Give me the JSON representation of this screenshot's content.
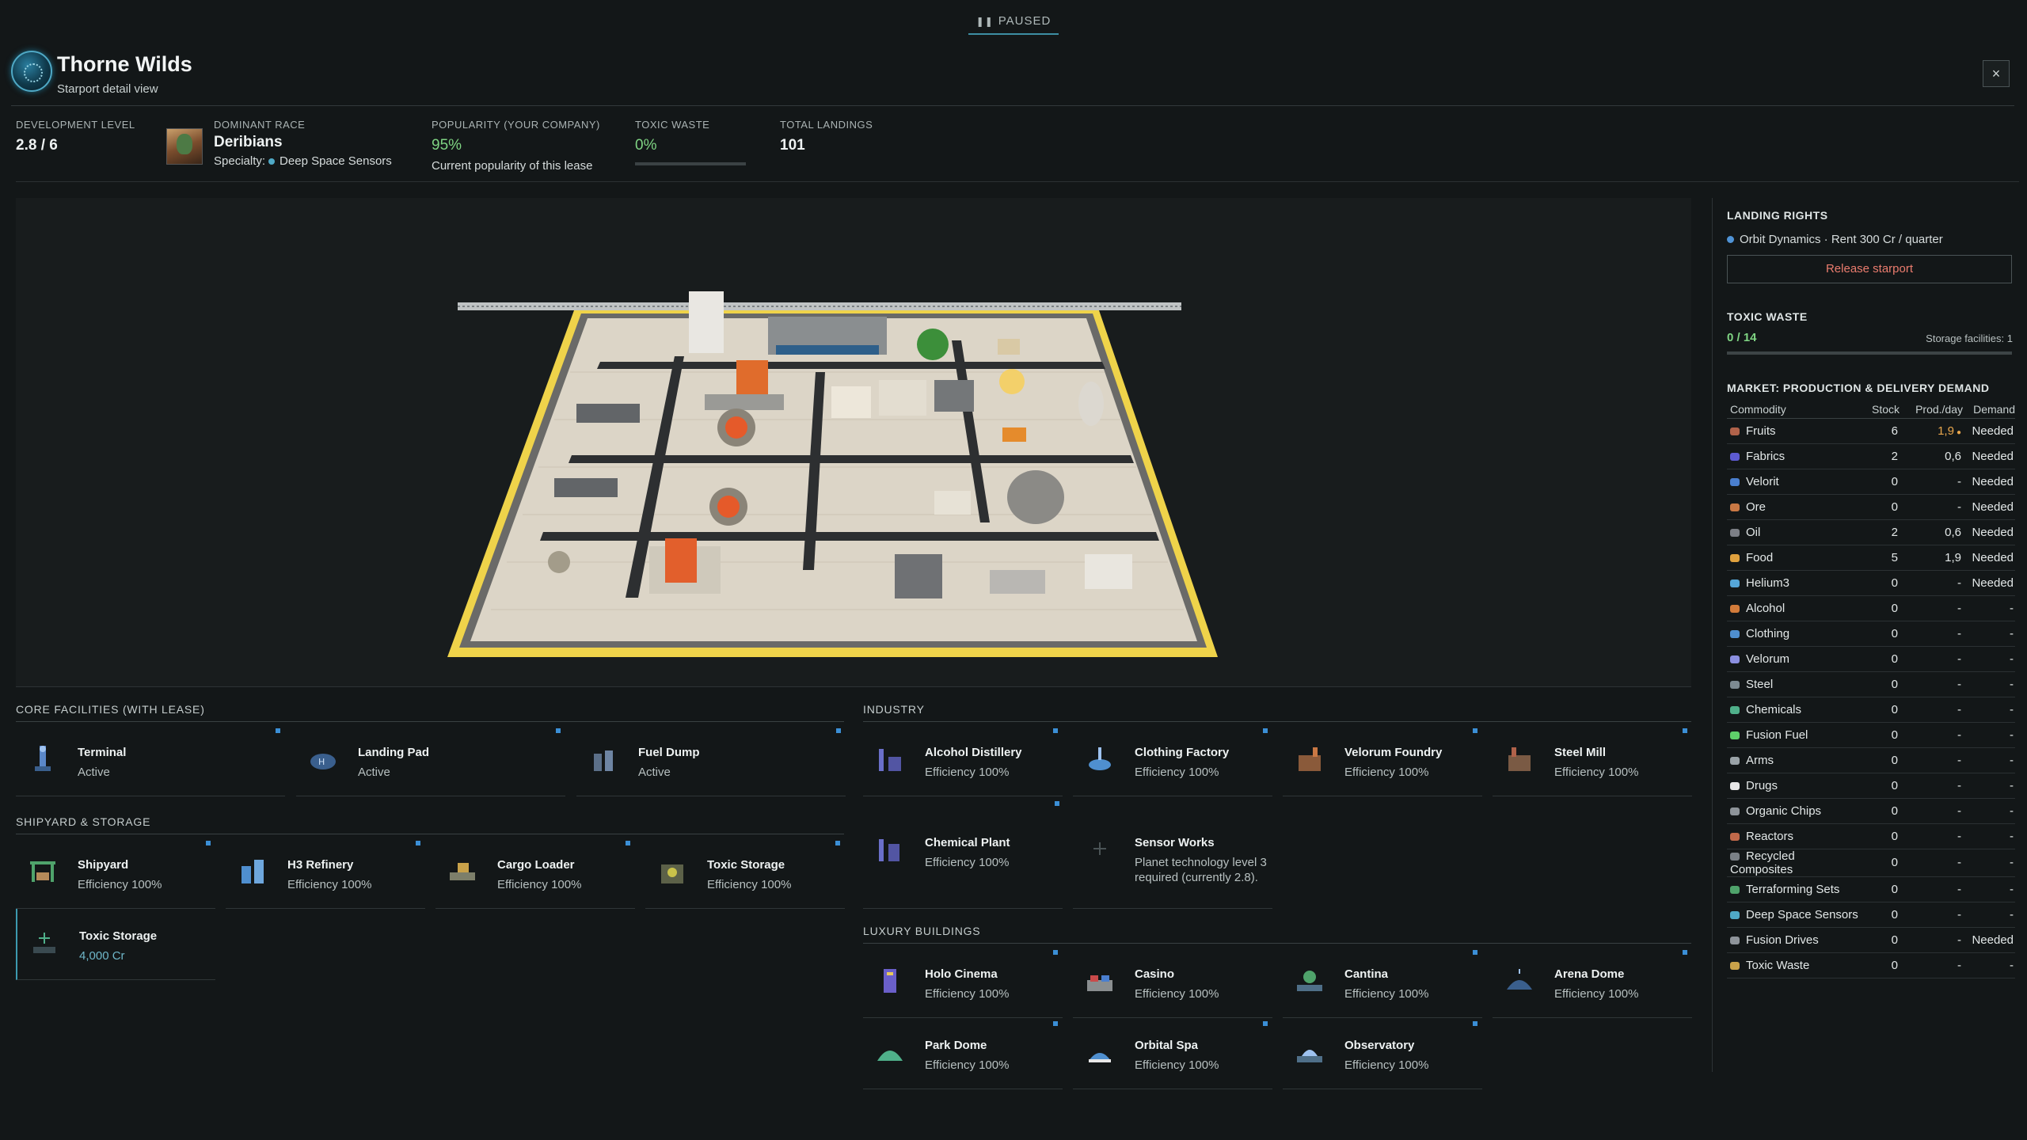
{
  "status": {
    "label": "PAUSED"
  },
  "header": {
    "title": "Thorne Wilds",
    "subtitle": "Starport detail view",
    "close": "×"
  },
  "stats": {
    "dev": {
      "label": "DEVELOPMENT LEVEL",
      "value": "2.8 / 6"
    },
    "race": {
      "label": "DOMINANT RACE",
      "value": "Deribians",
      "specialty_label": "Specialty:",
      "specialty": "Deep Space Sensors"
    },
    "popularity": {
      "label": "POPULARITY (YOUR COMPANY)",
      "value": "95%",
      "sub": "Current popularity of this lease"
    },
    "toxic": {
      "label": "TOXIC WASTE",
      "value": "0%"
    },
    "landings": {
      "label": "TOTAL LANDINGS",
      "value": "101"
    }
  },
  "sections": {
    "core": "CORE FACILITIES (WITH LEASE)",
    "industry": "INDUSTRY",
    "shipyard": "SHIPYARD & STORAGE",
    "luxury": "LUXURY BUILDINGS"
  },
  "core": [
    {
      "name": "Terminal",
      "status": "Active"
    },
    {
      "name": "Landing Pad",
      "status": "Active"
    },
    {
      "name": "Fuel Dump",
      "status": "Active"
    }
  ],
  "shipyard": [
    {
      "name": "Shipyard",
      "status": "Efficiency 100%"
    },
    {
      "name": "H3 Refinery",
      "status": "Efficiency 100%"
    },
    {
      "name": "Cargo Loader",
      "status": "Efficiency 100%"
    },
    {
      "name": "Toxic Storage",
      "status": "Efficiency 100%"
    },
    {
      "name": "Toxic Storage",
      "status": "4,000 Cr"
    }
  ],
  "industry": [
    {
      "name": "Alcohol Distillery",
      "status": "Efficiency 100%"
    },
    {
      "name": "Clothing Factory",
      "status": "Efficiency 100%"
    },
    {
      "name": "Velorum Foundry",
      "status": "Efficiency 100%"
    },
    {
      "name": "Steel Mill",
      "status": "Efficiency 100%"
    },
    {
      "name": "Chemical Plant",
      "status": "Efficiency 100%"
    },
    {
      "name": "Sensor Works",
      "status": "Planet technology level 3 required (currently 2.8)."
    }
  ],
  "luxury": [
    {
      "name": "Holo Cinema",
      "status": "Efficiency 100%"
    },
    {
      "name": "Casino",
      "status": "Efficiency 100%"
    },
    {
      "name": "Cantina",
      "status": "Efficiency 100%"
    },
    {
      "name": "Arena Dome",
      "status": "Efficiency 100%"
    },
    {
      "name": "Park Dome",
      "status": "Efficiency 100%"
    },
    {
      "name": "Orbital Spa",
      "status": "Efficiency 100%"
    },
    {
      "name": "Observatory",
      "status": "Efficiency 100%"
    }
  ],
  "side": {
    "landing_title": "LANDING RIGHTS",
    "landing_text": "Orbit Dynamics · Rent 300 Cr / quarter",
    "release": "Release starport",
    "toxic_title": "TOXIC WASTE",
    "toxic_value": "0 / 14",
    "toxic_storage": "Storage facilities: 1",
    "market_title": "MARKET: PRODUCTION & DELIVERY DEMAND",
    "market_headers": [
      "Commodity",
      "Stock",
      "Prod./day",
      "Demand"
    ],
    "market": [
      {
        "c": "Fruits",
        "s": "6",
        "p": "1,9",
        "d": "Needed",
        "color": "#b0624a"
      },
      {
        "c": "Fabrics",
        "s": "2",
        "p": "0,6",
        "d": "Needed",
        "color": "#5d5bd3"
      },
      {
        "c": "Velorit",
        "s": "0",
        "p": "-",
        "d": "Needed",
        "color": "#4a7fcf"
      },
      {
        "c": "Ore",
        "s": "0",
        "p": "-",
        "d": "Needed",
        "color": "#c97844"
      },
      {
        "c": "Oil",
        "s": "2",
        "p": "0,6",
        "d": "Needed",
        "color": "#7c7f86"
      },
      {
        "c": "Food",
        "s": "5",
        "p": "1,9",
        "d": "Needed",
        "color": "#e0a13e"
      },
      {
        "c": "Helium3",
        "s": "0",
        "p": "-",
        "d": "Needed",
        "color": "#55a6d8"
      },
      {
        "c": "Alcohol",
        "s": "0",
        "p": "-",
        "d": "-",
        "color": "#d27b3a"
      },
      {
        "c": "Clothing",
        "s": "0",
        "p": "-",
        "d": "-",
        "color": "#4f8fcf"
      },
      {
        "c": "Velorum",
        "s": "0",
        "p": "-",
        "d": "-",
        "color": "#8b8fe0"
      },
      {
        "c": "Steel",
        "s": "0",
        "p": "-",
        "d": "-",
        "color": "#7d8a92"
      },
      {
        "c": "Chemicals",
        "s": "0",
        "p": "-",
        "d": "-",
        "color": "#4fb08a"
      },
      {
        "c": "Fusion Fuel",
        "s": "0",
        "p": "-",
        "d": "-",
        "color": "#5fcf6a"
      },
      {
        "c": "Arms",
        "s": "0",
        "p": "-",
        "d": "-",
        "color": "#9aa3a8"
      },
      {
        "c": "Drugs",
        "s": "0",
        "p": "-",
        "d": "-",
        "color": "#e8e8e8"
      },
      {
        "c": "Organic Chips",
        "s": "0",
        "p": "-",
        "d": "-",
        "color": "#8e949a"
      },
      {
        "c": "Reactors",
        "s": "0",
        "p": "-",
        "d": "-",
        "color": "#c0694a"
      },
      {
        "c": "Recycled Composites",
        "s": "0",
        "p": "-",
        "d": "-",
        "color": "#7a8086"
      },
      {
        "c": "Terraforming Sets",
        "s": "0",
        "p": "-",
        "d": "-",
        "color": "#4fa36b"
      },
      {
        "c": "Deep Space Sensors",
        "s": "0",
        "p": "-",
        "d": "-",
        "color": "#4fa9c6"
      },
      {
        "c": "Fusion Drives",
        "s": "0",
        "p": "-",
        "d": "Needed",
        "color": "#8e949a"
      },
      {
        "c": "Toxic Waste",
        "s": "0",
        "p": "-",
        "d": "-",
        "color": "#c9a24a"
      }
    ]
  }
}
